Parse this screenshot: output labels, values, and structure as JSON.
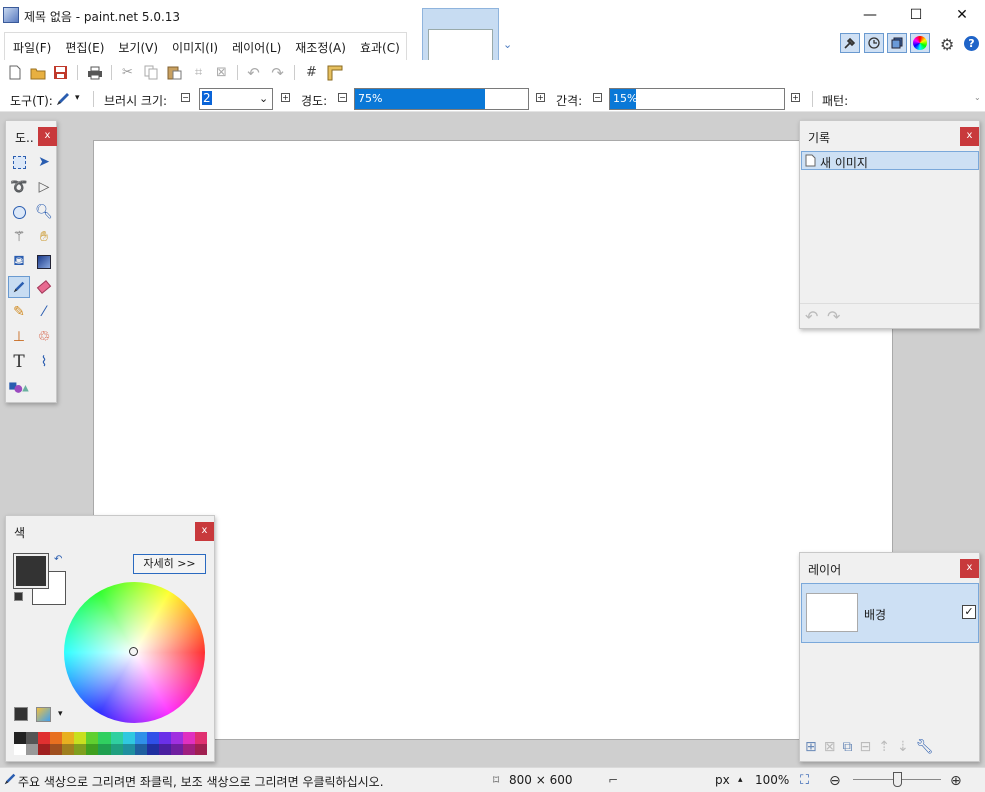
{
  "app": {
    "title": "제목 없음 - paint.net 5.0.13"
  },
  "window_controls": {
    "minimize": "—",
    "maximize": "☐",
    "close": "✕"
  },
  "menu": [
    {
      "label": "파일(F)"
    },
    {
      "label": "편집(E)"
    },
    {
      "label": "보기(V)"
    },
    {
      "label": "이미지(I)"
    },
    {
      "label": "레이어(L)"
    },
    {
      "label": "재조정(A)"
    },
    {
      "label": "효과(C)"
    }
  ],
  "toolbar_options": {
    "tool_label": "도구(T):",
    "brush_size_label": "브러시 크기:",
    "brush_size_value": "2",
    "hardness_label": "경도:",
    "hardness_value": "75%",
    "hardness_fraction": 0.75,
    "spacing_label": "간격:",
    "spacing_value": "15%",
    "spacing_fraction": 0.15,
    "pattern_label": "패턴:"
  },
  "tools_panel": {
    "title": "도..",
    "close": "x"
  },
  "history_panel": {
    "title": "기록",
    "close": "x",
    "items": [
      {
        "label": "새 이미지"
      }
    ]
  },
  "layers_panel": {
    "title": "레이어",
    "close": "x",
    "layers": [
      {
        "name": "배경",
        "visible": true
      }
    ]
  },
  "colors_panel": {
    "title": "색",
    "close": "x",
    "more_button": "자세히 >>",
    "primary_color": "#333333",
    "secondary_color": "#ffffff"
  },
  "status": {
    "hint": "주요 색상으로 그리려면 좌클릭, 보조 색상으로 그리려면 우클릭하십시오.",
    "image_size": "800 × 600",
    "unit": "px",
    "zoom": "100%"
  },
  "colors": {
    "accent": "#0a78d7",
    "selection": "#cde0f4",
    "close_button": "#c8393c",
    "workspace": "#cfcfcf"
  }
}
